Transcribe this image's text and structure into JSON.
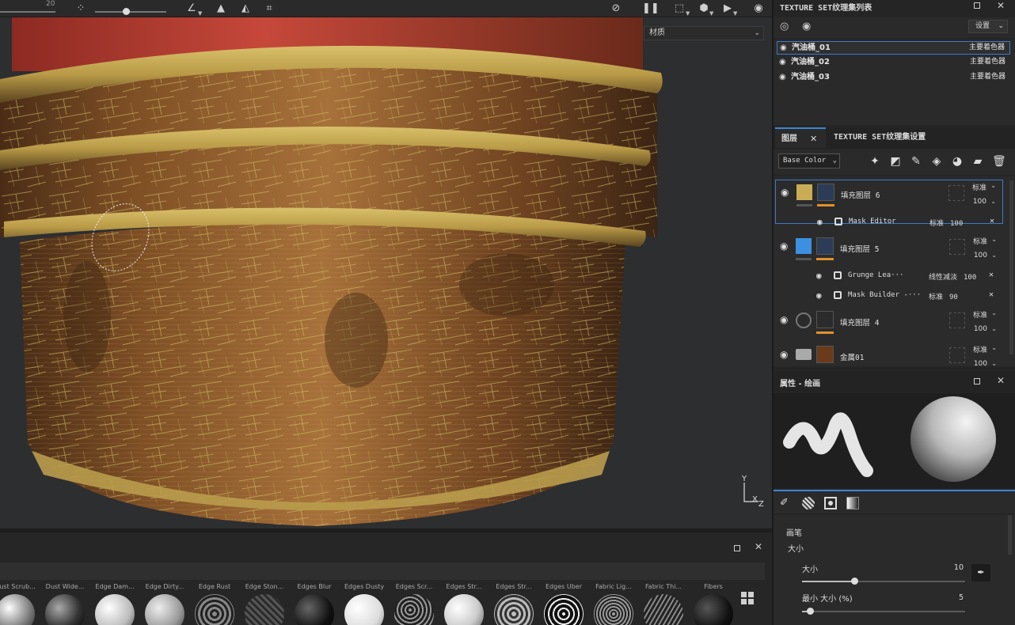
{
  "viewport": {
    "material_dropdown": "材质",
    "axis": {
      "y": "Y",
      "x": "X",
      "z": "Z"
    },
    "toolbar_value": "20"
  },
  "texture_sets": {
    "title": "TEXTURE SET纹理集列表",
    "settings_label": "设置",
    "items": [
      {
        "name": "汽油桶_01",
        "shader": "主要着色器",
        "selected": true
      },
      {
        "name": "汽油桶_02",
        "shader": "主要着色器",
        "selected": false
      },
      {
        "name": "汽油桶_03",
        "shader": "主要着色器",
        "selected": false
      }
    ]
  },
  "tabs": {
    "layers": "图层",
    "texture_set_settings": "TEXTURE SET纹理集设置"
  },
  "layers_panel": {
    "channel": "Base Color",
    "layers": [
      {
        "name": "填充图层 6",
        "blend": "标准",
        "opacity": "100",
        "color": "#c9ad56",
        "selected": true,
        "subs": [
          {
            "name": "Mask Editor",
            "blend": "标准",
            "opacity": "100"
          }
        ]
      },
      {
        "name": "填充图层 5",
        "blend": "标准",
        "opacity": "100",
        "color": "#3d8fdf",
        "selected": false,
        "subs": [
          {
            "name": "Grunge Lea···",
            "blend": "线性减淡",
            "opacity": "100"
          },
          {
            "name": "Mask Builder -···",
            "blend": "标准",
            "opacity": "90"
          }
        ]
      },
      {
        "name": "填充图层 4",
        "blend": "标准",
        "opacity": "100",
        "color": "",
        "selected": false,
        "subs": []
      },
      {
        "name": "金属01",
        "blend": "标准",
        "opacity": "100",
        "color": "",
        "selected": false,
        "subs": []
      }
    ]
  },
  "properties": {
    "title": "属性 - 绘画",
    "section": "画笔",
    "group": "大小",
    "size_label": "大小",
    "size_value": "10",
    "size_fraction": 0.32,
    "min_size_label": "最小 大小 (%)",
    "min_size_value": "5",
    "min_size_fraction": 0.05
  },
  "shelf": {
    "materials": [
      "Dust Scrub...",
      "Dust Wide...",
      "Edge Dam...",
      "Edge Dirty...",
      "Edge Rust",
      "Edge Ston...",
      "Edges Blur",
      "Edges Dusty",
      "Edges Scr...",
      "Edges Str...",
      "Edges Str...",
      "Edges Uber",
      "Fabric Lig...",
      "Fabric Thi...",
      "Fibers"
    ]
  },
  "colors": {
    "accent": "#3d86d6",
    "barrel_rust": "#7a4a24",
    "barrel_yellow": "#c9ad56"
  }
}
